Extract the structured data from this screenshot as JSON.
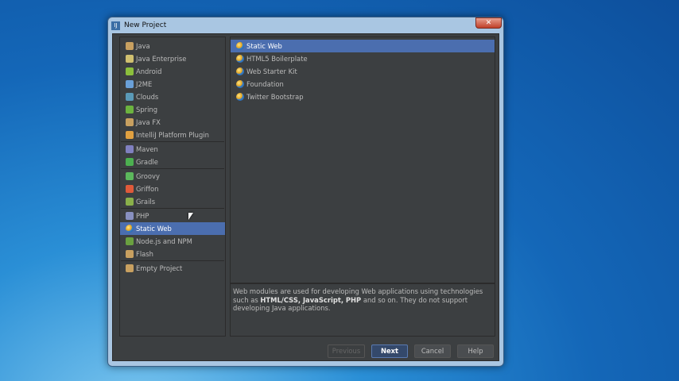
{
  "window": {
    "title": "New Project",
    "close": "✕"
  },
  "left_groups": [
    [
      {
        "label": "Java",
        "color": "#c8a060"
      },
      {
        "label": "Java Enterprise",
        "color": "#d0c070"
      },
      {
        "label": "Android",
        "color": "#8bbf3c"
      },
      {
        "label": "J2ME",
        "color": "#6aa0d8"
      },
      {
        "label": "Clouds",
        "color": "#5a9ab8"
      },
      {
        "label": "Spring",
        "color": "#6cb33f"
      },
      {
        "label": "Java FX",
        "color": "#c8a060"
      },
      {
        "label": "IntelliJ Platform Plugin",
        "color": "#e0a040"
      }
    ],
    [
      {
        "label": "Maven",
        "color": "#8080c0"
      },
      {
        "label": "Gradle",
        "color": "#4caf50"
      }
    ],
    [
      {
        "label": "Groovy",
        "color": "#5cb85c"
      },
      {
        "label": "Griffon",
        "color": "#e05a3a"
      },
      {
        "label": "Grails",
        "color": "#8ab04a"
      }
    ],
    [
      {
        "label": "PHP",
        "color": "#8890c0"
      },
      {
        "label": "Static Web",
        "color": "#e0b030",
        "selected": true
      },
      {
        "label": "Node.js and NPM",
        "color": "#6aa040"
      },
      {
        "label": "Flash",
        "color": "#c8a060"
      }
    ],
    [
      {
        "label": "Empty Project",
        "color": "#c8a060"
      }
    ]
  ],
  "templates": [
    "Static Web",
    "HTML5 Boilerplate",
    "Web Starter Kit",
    "Foundation",
    "Twitter Bootstrap"
  ],
  "description": {
    "pre": "Web modules are used for developing Web applications using technologies such as ",
    "bold": "HTML/CSS, JavaScript, PHP",
    "post": " and so on. They do not support developing Java applications."
  },
  "buttons": {
    "previous": "Previous",
    "next": "Next",
    "cancel": "Cancel",
    "help": "Help"
  }
}
